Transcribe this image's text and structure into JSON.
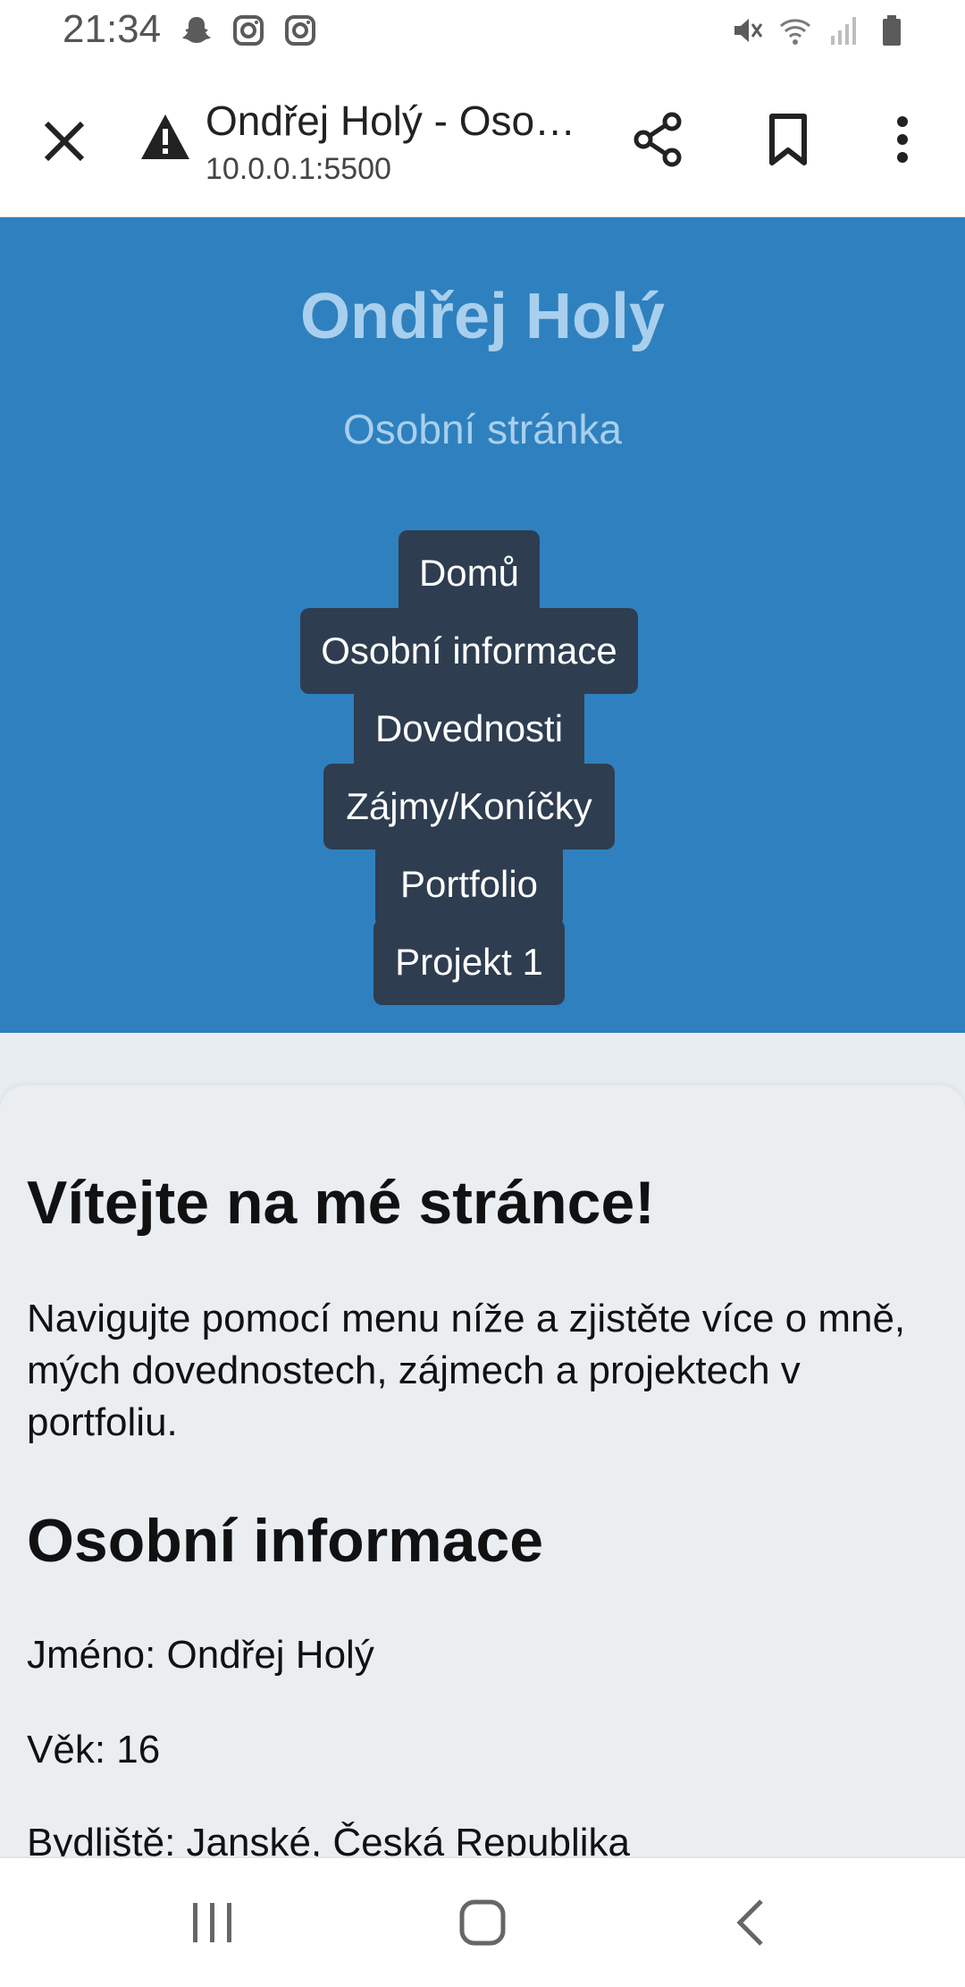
{
  "status_bar": {
    "time": "21:34",
    "left_icons": [
      "snapchat-icon",
      "instagram-icon",
      "instagram-icon"
    ],
    "right_icons": [
      "mute-icon",
      "wifi-icon",
      "signal-icon",
      "battery-icon"
    ]
  },
  "browser": {
    "title": "Ondřej Holý - Oso…",
    "url": "10.0.0.1:5500",
    "icons": [
      "close-icon",
      "warning-icon",
      "share-icon",
      "bookmark-icon",
      "more-vertical-icon"
    ]
  },
  "hero": {
    "title": "Ondřej Holý",
    "subtitle": "Osobní stránka"
  },
  "nav": {
    "items": [
      {
        "label": "Domů"
      },
      {
        "label": "Osobní informace"
      },
      {
        "label": "Dovednosti"
      },
      {
        "label": "Zájmy/Koníčky"
      },
      {
        "label": "Portfolio"
      },
      {
        "label": "Projekt 1"
      }
    ]
  },
  "content": {
    "welcome_heading": "Vítejte na mé stránce!",
    "intro": "Navigujte pomocí menu níže a zjistěte více o mně, mých dovednostech, zájmech a projektech v portfoliu.",
    "info_heading": "Osobní informace",
    "info_lines": [
      "Jméno: Ondřej Holý",
      "Věk: 16",
      "Bydliště: Janské, Česká Republika"
    ]
  },
  "colors": {
    "hero_bg": "#2e81be",
    "hero_text": "#a9cfee",
    "nav_bg": "#2e3d50",
    "content_bg": "#ebeef1"
  },
  "system_nav": {
    "icons": [
      "recent-apps-icon",
      "home-icon",
      "back-icon"
    ]
  }
}
